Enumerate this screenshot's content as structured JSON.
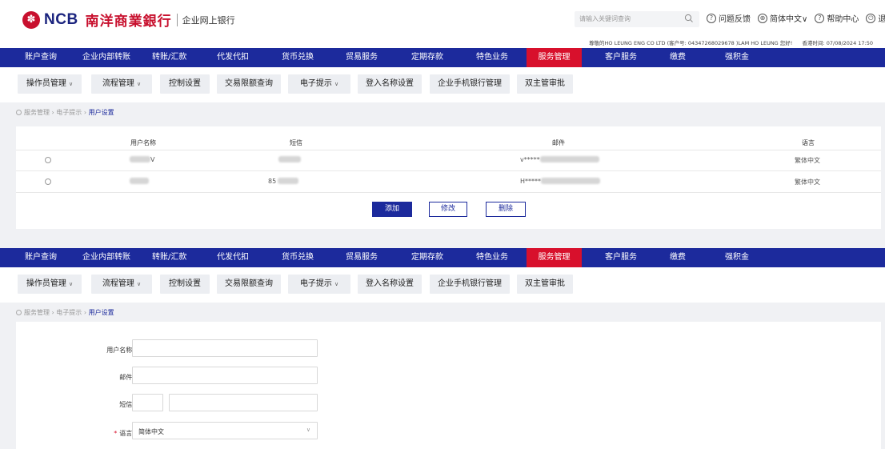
{
  "header": {
    "logo_mark": "✽",
    "logo_ncb": "NCB",
    "logo_cn": "南洋商業銀行",
    "logo_sub": "企业网上银行",
    "search_placeholder": "请输入关键词查询",
    "links": [
      {
        "icon": "question-icon",
        "glyph": "?",
        "label": "问题反馈"
      },
      {
        "icon": "globe-icon",
        "glyph": "⊕",
        "label": "简体中文∨"
      },
      {
        "icon": "help-icon",
        "glyph": "?",
        "label": "帮助中心"
      },
      {
        "icon": "power-icon",
        "glyph": "⏻",
        "label": "退出"
      }
    ],
    "greeting": "尊敬的HO LEUNG ENG CO LTD (客户号: 04347268029678 )LAM HO LEUNG 您好!",
    "time": "香港时间: 07/08/2024 17:50"
  },
  "nav": {
    "items": [
      "账户查询",
      "企业内部转账",
      "转账/汇款",
      "代发代扣",
      "货币兑换",
      "贸易服务",
      "定期存款",
      "特色业务",
      "服务管理",
      "客户服务",
      "缴费",
      "强积金"
    ],
    "active": "服务管理"
  },
  "subnav": {
    "items": [
      "操作员管理",
      "流程管理",
      "控制设置",
      "交易限额查询",
      "电子提示",
      "登入名称设置",
      "企业手机银行管理",
      "双主管审批"
    ]
  },
  "breadcrumb": {
    "parts": [
      "服务管理",
      "电子提示"
    ],
    "sep": "›",
    "current": "用户设置"
  },
  "table": {
    "headers": [
      "用户名称",
      "短信",
      "邮件",
      "语言"
    ],
    "rows": [
      {
        "name_visible": "V",
        "sms_visible": "",
        "email_visible": "v*****",
        "lang": "繁体中文"
      },
      {
        "name_visible": "",
        "sms_visible": "85",
        "email_visible": "H*****",
        "lang": "繁体中文"
      }
    ],
    "buttons": {
      "add": "添加",
      "edit": "修改",
      "delete": "删除"
    }
  },
  "form": {
    "labels": {
      "username": "用户名称:",
      "email": "邮件:",
      "sms": "短信:",
      "language": "语言:"
    },
    "required_mark": "*",
    "language_value": "简体中文"
  },
  "colors": {
    "nav_bg": "#1c2a9c",
    "active_tab": "#d8102c"
  }
}
